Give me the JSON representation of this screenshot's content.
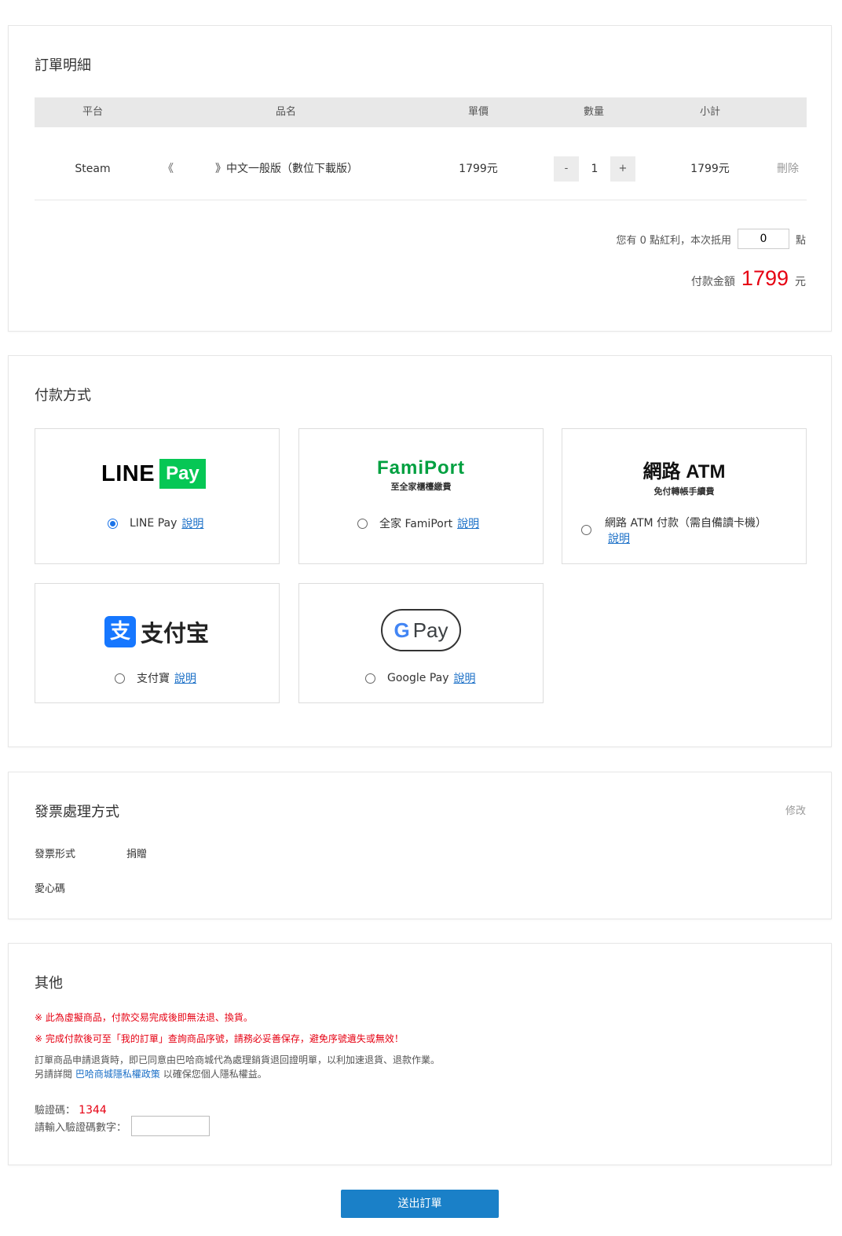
{
  "order": {
    "title": "訂單明細",
    "headers": [
      "平台",
      "品名",
      "單價",
      "數量",
      "小計"
    ],
    "item": {
      "platform": "Steam",
      "name_open": "《",
      "name_rest": "》中文一般版（數位下載版）",
      "price": "1799元",
      "minus": "-",
      "qty": "1",
      "plus": "+",
      "subtotal": "1799元",
      "delete": "刪除"
    },
    "points_text": "您有 0 點紅利，本次抵用",
    "points_value": "0",
    "points_unit": "點",
    "total_label": "付款金額",
    "total_amount": "1799",
    "total_unit": "元"
  },
  "payment": {
    "title": "付款方式",
    "methods": [
      {
        "label": "LINE Pay",
        "link": "說明",
        "logo_text": "LINE",
        "logo_badge": "Pay"
      },
      {
        "label": "全家 FamiPort",
        "link": "說明",
        "logo_text": "FamiPort",
        "logo_sub": "至全家櫃檯繳費"
      },
      {
        "label": "網路 ATM 付款（需自備讀卡機）",
        "link": "說明",
        "logo_text": "網路 ATM",
        "logo_sub": "免付轉帳手續費"
      },
      {
        "label": "支付寶",
        "link": "說明",
        "logo_text": "支付宝",
        "logo_icon": "支"
      },
      {
        "label": "Google Pay",
        "link": "說明",
        "logo_text": "Pay",
        "logo_g": "G"
      }
    ],
    "selected": 0,
    "colors": {
      "line_green": "#06c755",
      "fami_green": "#00a040",
      "fami_blue": "#0090d8",
      "alipay_blue": "#1677ff"
    }
  },
  "invoice": {
    "title": "發票處理方式",
    "edit": "修改",
    "type_label": "發票形式",
    "type_value": "捐贈",
    "love_label": "愛心碼"
  },
  "other": {
    "title": "其他",
    "note1": "※ 此為虛擬商品，付款交易完成後即無法退、換貨。",
    "note2": "※ 完成付款後可至「我的訂單」查詢商品序號，請務必妥善保存，避免序號遺失或無效！",
    "note3": "訂單商品申請退貨時，即已同意由巴哈商城代為處理銷貨退回證明單，以利加速退貨、退款作業。",
    "note4_pre": "另請詳閱",
    "note4_link": "巴哈商城隱私權政策",
    "note4_post": "以確保您個人隱私權益。",
    "captcha_label": "驗證碼：",
    "captcha_value": "1344",
    "captcha_input_label": "請輸入驗證碼數字："
  },
  "submit": "送出訂單"
}
